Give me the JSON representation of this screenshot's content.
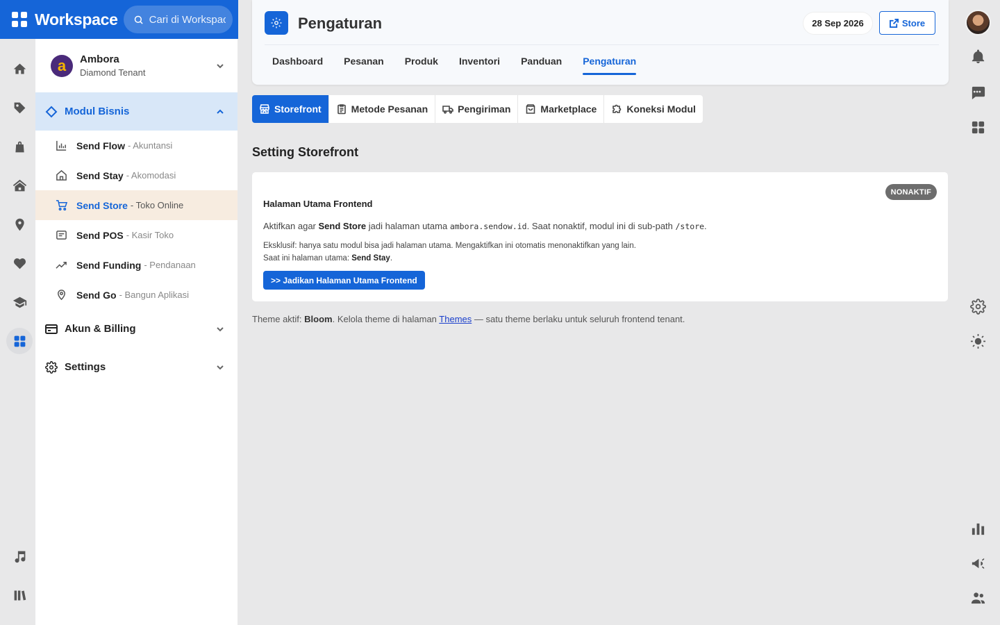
{
  "brand": {
    "name": "Workspace",
    "search_placeholder": "Cari di Workspace"
  },
  "tenant": {
    "name": "Ambora",
    "tier": "Diamond Tenant",
    "avatar_letter": "a"
  },
  "sidebar": {
    "modul_bisnis": {
      "label": "Modul Bisnis",
      "items": [
        {
          "name": "Send Flow",
          "desc": "- Akuntansi",
          "icon": "chart-icon"
        },
        {
          "name": "Send Stay",
          "desc": "- Akomodasi",
          "icon": "home-icon"
        },
        {
          "name": "Send Store",
          "desc": "- Toko Online",
          "icon": "cart-icon",
          "active": true
        },
        {
          "name": "Send POS",
          "desc": "- Kasir Toko",
          "icon": "receipt-icon"
        },
        {
          "name": "Send Funding",
          "desc": "- Pendanaan",
          "icon": "trending-icon"
        },
        {
          "name": "Send Go",
          "desc": "- Bangun Aplikasi",
          "icon": "location-icon"
        }
      ]
    },
    "akun_billing": {
      "label": "Akun & Billing"
    },
    "settings": {
      "label": "Settings"
    }
  },
  "header": {
    "title": "Pengaturan",
    "date": "28 Sep 2026",
    "store_button": "Store",
    "tabs": [
      "Dashboard",
      "Pesanan",
      "Produk",
      "Inventori",
      "Panduan",
      "Pengaturan"
    ],
    "active_tab": "Pengaturan"
  },
  "subtabs": {
    "storefront": "Storefront",
    "metode": "Metode Pesanan",
    "pengiriman": "Pengiriman",
    "marketplace": "Marketplace",
    "koneksi": "Koneksi Modul",
    "active": "Storefront"
  },
  "section_title": "Setting Storefront",
  "card": {
    "badge": "NONAKTIF",
    "title": "Halaman Utama Frontend",
    "line1_a": "Aktifkan agar ",
    "line1_b": "Send Store",
    "line1_c": " jadi halaman utama ",
    "line1_domain": "ambora.sendow.id",
    "line1_d": ". Saat nonaktif, modul ini di sub-path ",
    "line1_path": "/store",
    "line1_e": ".",
    "line2": "Eksklusif: hanya satu modul bisa jadi halaman utama. Mengaktifkan ini otomatis menonaktifkan yang lain.",
    "line3_a": "Saat ini halaman utama: ",
    "line3_b": "Send Stay",
    "line3_c": ".",
    "button": ">> Jadikan Halaman Utama Frontend"
  },
  "theme_note": {
    "a": "Theme aktif: ",
    "b": "Bloom",
    "c": ". Kelola theme di halaman ",
    "link": "Themes",
    "d": " — satu theme berlaku untuk seluruh frontend tenant."
  },
  "colors": {
    "primary": "#1565d8",
    "active_row": "#f7ece0",
    "section_open": "#d8e7f8",
    "badge": "#6d6d6d"
  }
}
